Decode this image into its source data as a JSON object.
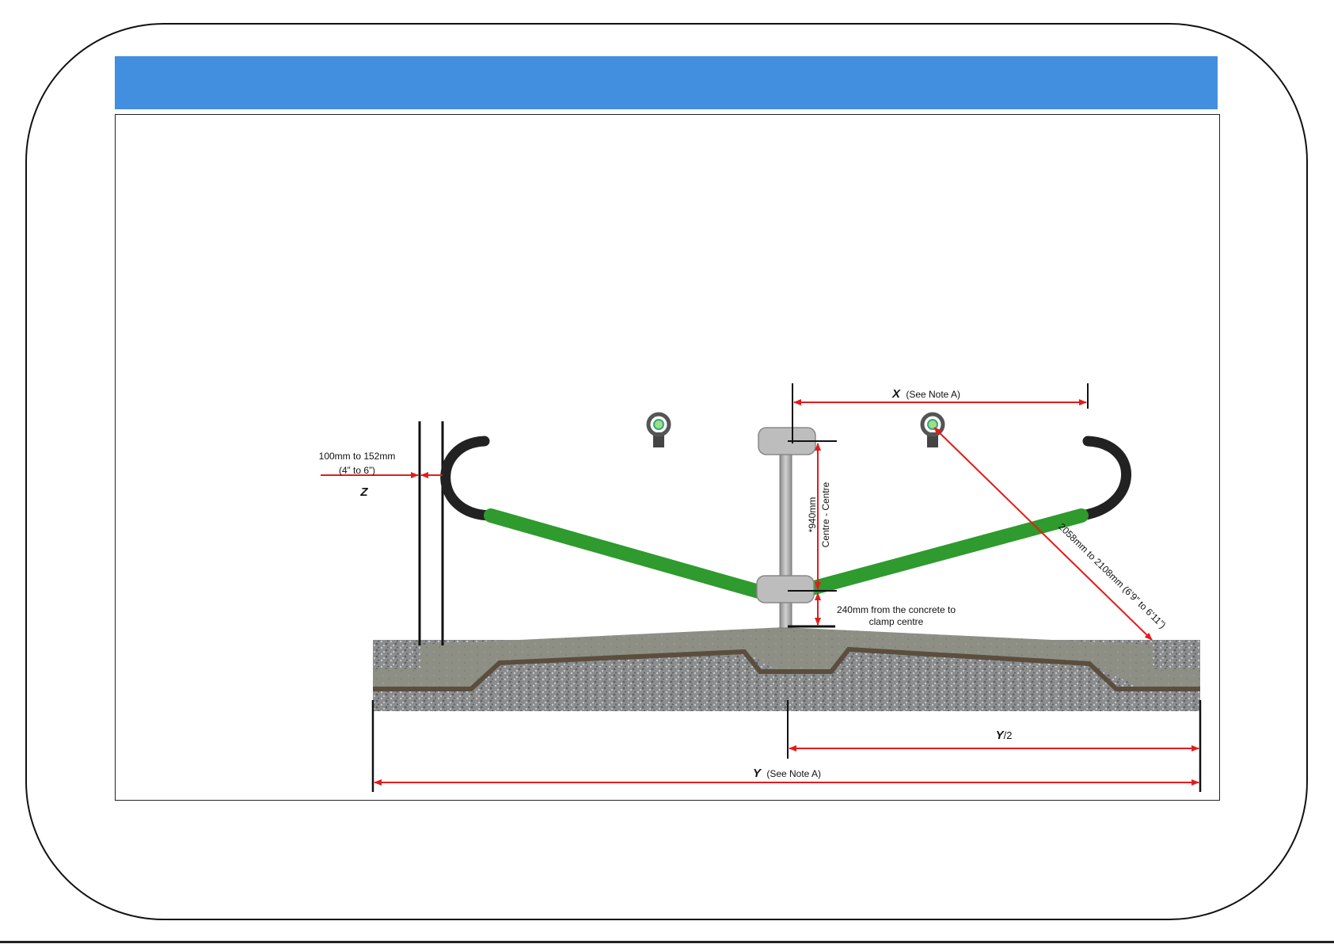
{
  "diagram": {
    "dim_z_range": "100mm to 152mm",
    "dim_z_range_imperial": "(4” to 6”)",
    "dim_z_letter": "Z",
    "dim_x_letter": "X",
    "dim_x_note": "(See Note A)",
    "dim_center_value": "*940mm",
    "dim_center_text": "Centre - Centre",
    "dim_ground_line1": "240mm from the concrete to",
    "dim_ground_line2": "clamp centre",
    "dim_diagonal": "2058mm to 2108mm (6’9” to 6’11”)",
    "dim_half_y_letter": "Y",
    "dim_half_y_suffix": "/2",
    "dim_y_letter": "Y",
    "dim_y_note": "(See Note A)"
  },
  "colors": {
    "header_blue": "#428fdf",
    "pipe_green": "#2f9a2e",
    "dimension_red": "#e41b1b",
    "concrete": "#8e8f84",
    "gravel": "#8b8d8e",
    "soil": "#5b4e3e",
    "clamp_grey": "#bdbdbd",
    "hose_black": "#222222"
  }
}
